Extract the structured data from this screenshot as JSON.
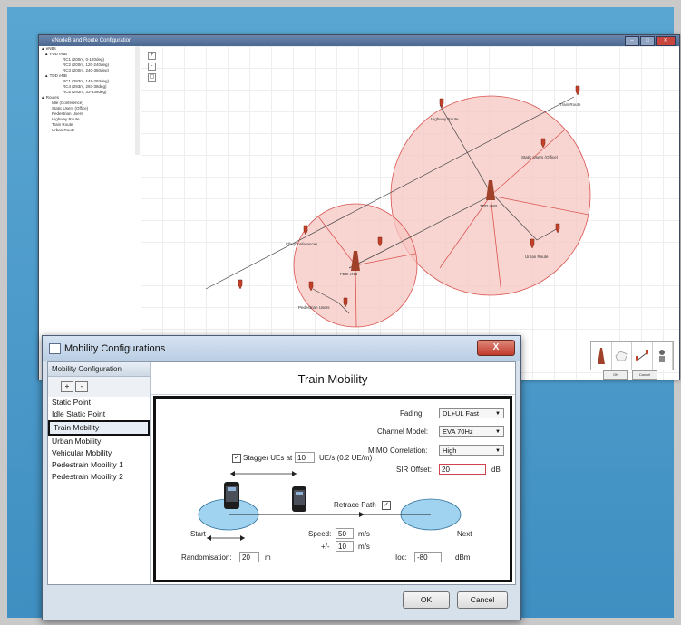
{
  "back_window": {
    "title": "eNodeB and Route Configuration",
    "tree": [
      "▲ eNBs",
      "  ▲ FDD eNB",
      "      RC1 (200m, 0-120deg)",
      "      RC2 (200m, 120-240deg)",
      "      RC3 (200m, 240-360deg)",
      "  ▲ TDD eNB",
      "      RC1 (293m, 148-293deg)",
      "      RC4 (293m, 293-38deg)",
      "      RC5 (293m, 33-148deg)",
      "▲ Routes",
      "    Idle (Conference)",
      "    Static Users (Office)",
      "    Pedestrian Users",
      "    Highway Route",
      "    Train Route",
      "    Urban Route"
    ],
    "map_labels": {
      "train_route": "Train Route",
      "highway_route": "Highway Route",
      "static_users": "Static Users (Office)",
      "tdd_enb": "TDD eNB",
      "idle_conference": "Idle (Conference)",
      "fdd_enb": "FDD eNB",
      "pedestrian": "Pedestrian Users",
      "urban_route": "Urban Route"
    },
    "ok_label": "OK",
    "cancel_label": "Cancel"
  },
  "dialog": {
    "title": "Mobility Configurations",
    "close_label": "X",
    "left_header": "Mobility Configuration",
    "add_label": "+",
    "remove_label": "-",
    "items": [
      {
        "label": "Static Point",
        "selected": false
      },
      {
        "label": "Idle Static Point",
        "selected": false
      },
      {
        "label": "Train Mobility",
        "selected": true
      },
      {
        "label": "Urban Mobility",
        "selected": false
      },
      {
        "label": "Vehicular Mobility",
        "selected": false
      },
      {
        "label": "Pedestrain Mobility 1",
        "selected": false
      },
      {
        "label": "Pedestrain Mobility 2",
        "selected": false
      }
    ],
    "panel_title": "Train Mobility",
    "fading_label": "Fading:",
    "fading_value": "DL+UL Fast",
    "channel_model_label": "Channel Model:",
    "channel_model_value": "EVA 70Hz",
    "mimo_label": "MIMO Correlation:",
    "mimo_value": "High",
    "sir_label": "SIR Offset:",
    "sir_value": "20",
    "sir_unit": "dB",
    "stagger_label": "Stagger UEs at",
    "stagger_value": "10",
    "stagger_unit": "UE/s (0.2 UE/m)",
    "stagger_checked": true,
    "retrace_label": "Retrace Path",
    "retrace_checked": true,
    "start_label": "Start",
    "next_label": "Next",
    "speed_label": "Speed:",
    "speed_value": "50",
    "speed_unit": "m/s",
    "pm_label": "+/-",
    "pm_value": "10",
    "pm_unit": "m/s",
    "randomisation_label": "Randomisation:",
    "randomisation_value": "20",
    "randomisation_unit": "m",
    "ioc_label": "Ioc:",
    "ioc_value": "-80",
    "ioc_unit": "dBm",
    "ok_label": "OK",
    "cancel_label": "Cancel"
  },
  "colors": {
    "cell_fill": "#f7c7c3",
    "cell_stroke": "#d9534f",
    "ellipse": "#9fd3f0",
    "desktop": "#4e9bc8"
  }
}
